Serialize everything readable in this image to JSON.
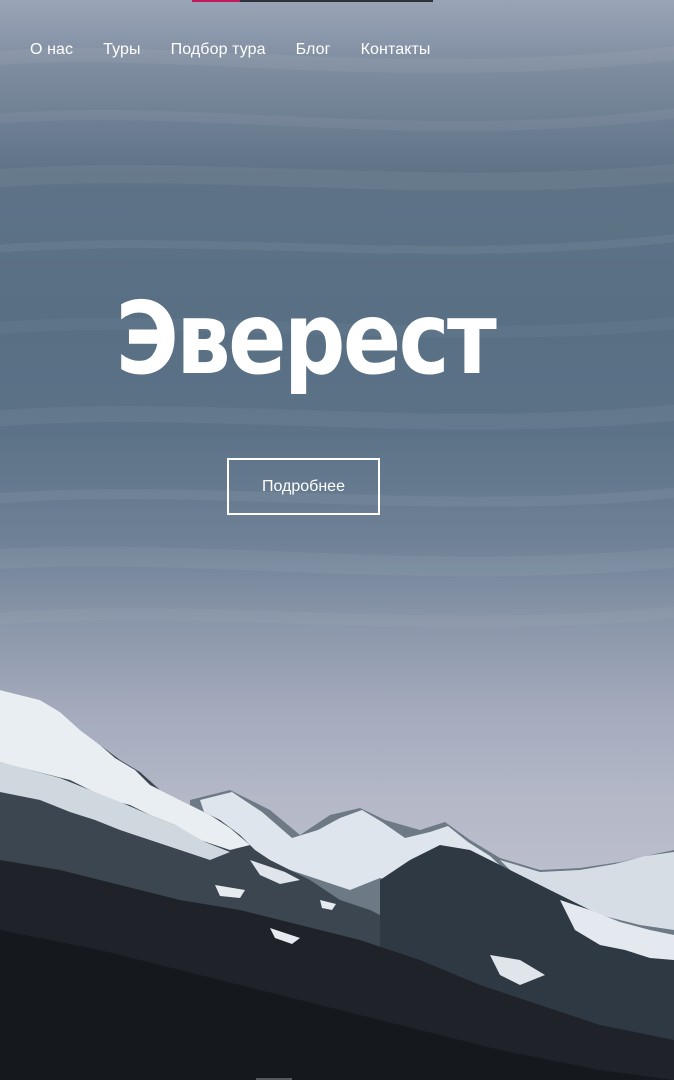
{
  "nav": {
    "items": [
      {
        "label": "О нас"
      },
      {
        "label": "Туры"
      },
      {
        "label": "Подбор тура"
      },
      {
        "label": "Блог"
      },
      {
        "label": "Контакты"
      }
    ]
  },
  "hero": {
    "title": "Эверест",
    "button_label": "Подробнее"
  },
  "slider": {
    "progress_fraction": 0.2,
    "accent_color": "#c2185b"
  },
  "colors": {
    "text": "#ffffff"
  }
}
